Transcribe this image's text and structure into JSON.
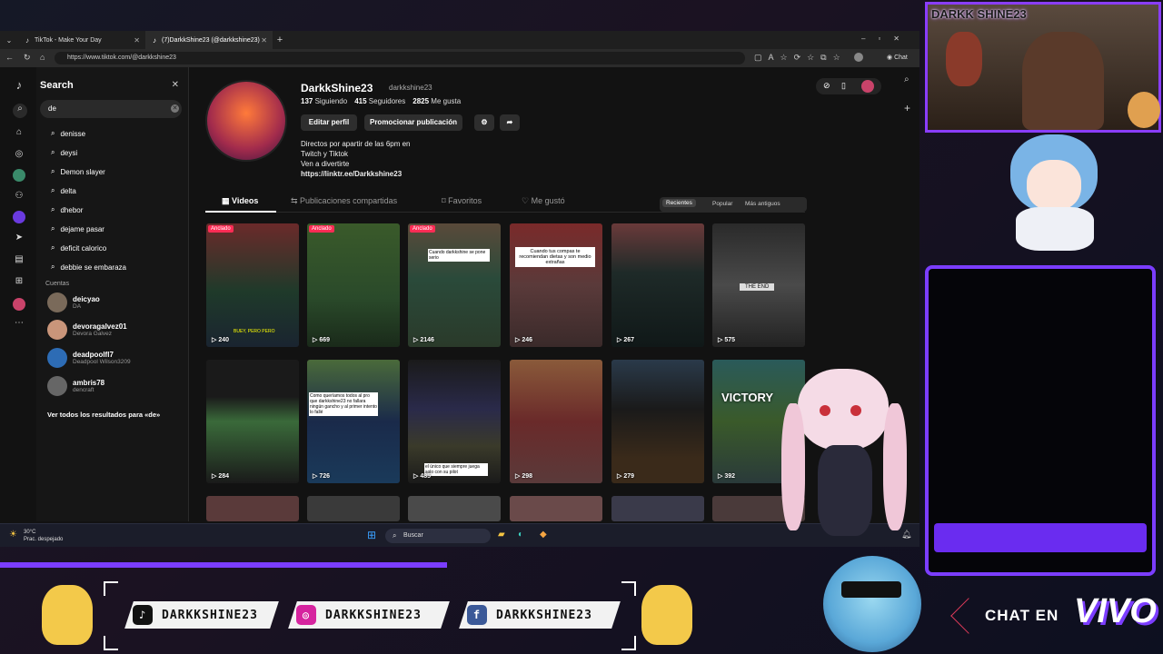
{
  "browser": {
    "tabs": [
      {
        "label": "TikTok - Make Your Day"
      },
      {
        "label": "(7)DarkkShine23 (@darkkshine23)"
      }
    ],
    "url": "https://www.tiktok.com/@darkkshine23",
    "chat_label": "Chat"
  },
  "search": {
    "title": "Search",
    "query": "de",
    "suggestions": [
      "denisse",
      "deysi",
      "Demon slayer",
      "delta",
      "dhebor",
      "dejame pasar",
      "deficit calorico",
      "debbie se embaraza"
    ],
    "accounts_header": "Cuentas",
    "accounts": [
      {
        "name": "deicyao",
        "sub": "DA"
      },
      {
        "name": "devoragalvez01",
        "sub": "Devora Galvez"
      },
      {
        "name": "deadpoolfl7",
        "sub": "Deadpool Wilson3209"
      },
      {
        "name": "ambris78",
        "sub": "dencraft"
      }
    ],
    "see_all": "Ver todos los resultados para «de»"
  },
  "profile": {
    "name": "DarkkShine23",
    "username": "darkkshine23",
    "following_count": "137",
    "following_label": "Siguiendo",
    "followers_count": "415",
    "followers_label": "Seguidores",
    "likes_count": "2825",
    "likes_label": "Me gusta",
    "edit_button": "Editar perfil",
    "promote_button": "Promocionar publicación",
    "bio": [
      "Directos por apartir de las 6pm en",
      "Twitch y Tiktok",
      "Ven a divertirte",
      "https://linktr.ee/Darkkshine23"
    ],
    "tabs": [
      "Videos",
      "Publicaciones compartidas",
      "Favoritos",
      "Me gustó"
    ],
    "sort": [
      "Recientes",
      "Popular",
      "Más antiguos"
    ],
    "pinned_label": "Anclado"
  },
  "videos": [
    {
      "views": "240",
      "pinned": true,
      "caption": "BUEY, PERO PERO"
    },
    {
      "views": "669",
      "pinned": true,
      "caption": ""
    },
    {
      "views": "2146",
      "pinned": true,
      "caption": "Cuando darkkshine se pone serio"
    },
    {
      "views": "246",
      "pinned": false,
      "caption": "Cuando tus compas te recomiendan dietas y son medio extrañas"
    },
    {
      "views": "267",
      "pinned": false,
      "caption": ""
    },
    {
      "views": "575",
      "pinned": false,
      "caption": "THE END"
    },
    {
      "views": "284",
      "pinned": false,
      "caption": ""
    },
    {
      "views": "726",
      "pinned": false,
      "caption": "Como queríamos todos al pro que darkkshine23 no fallara ningún gancho y al primer intento lo fallé"
    },
    {
      "views": "485",
      "pinned": false,
      "caption": "el único que siempre juega solo con su pilot"
    },
    {
      "views": "298",
      "pinned": false,
      "caption": ""
    },
    {
      "views": "279",
      "pinned": false,
      "caption": ""
    },
    {
      "views": "392",
      "pinned": false,
      "caption": "VICTORY"
    }
  ],
  "taskbar": {
    "temperature": "30°C",
    "weather": "Prac. despejado",
    "search_placeholder": "Buscar"
  },
  "overlay": {
    "cam_name": "DARKK SHINE23",
    "socials": [
      {
        "network": "tiktok",
        "handle": "DARKKSHINE23",
        "color": "#111111",
        "icon": "♪"
      },
      {
        "network": "instagram",
        "handle": "DARKKSHINE23",
        "color": "#d6249f",
        "icon": "◎"
      },
      {
        "network": "facebook",
        "handle": "DARKKSHINE23",
        "color": "#3b5998",
        "icon": "f"
      }
    ],
    "chat_en": "CHAT EN",
    "vivo": "VIVO",
    "accent": "#7b3dff"
  }
}
